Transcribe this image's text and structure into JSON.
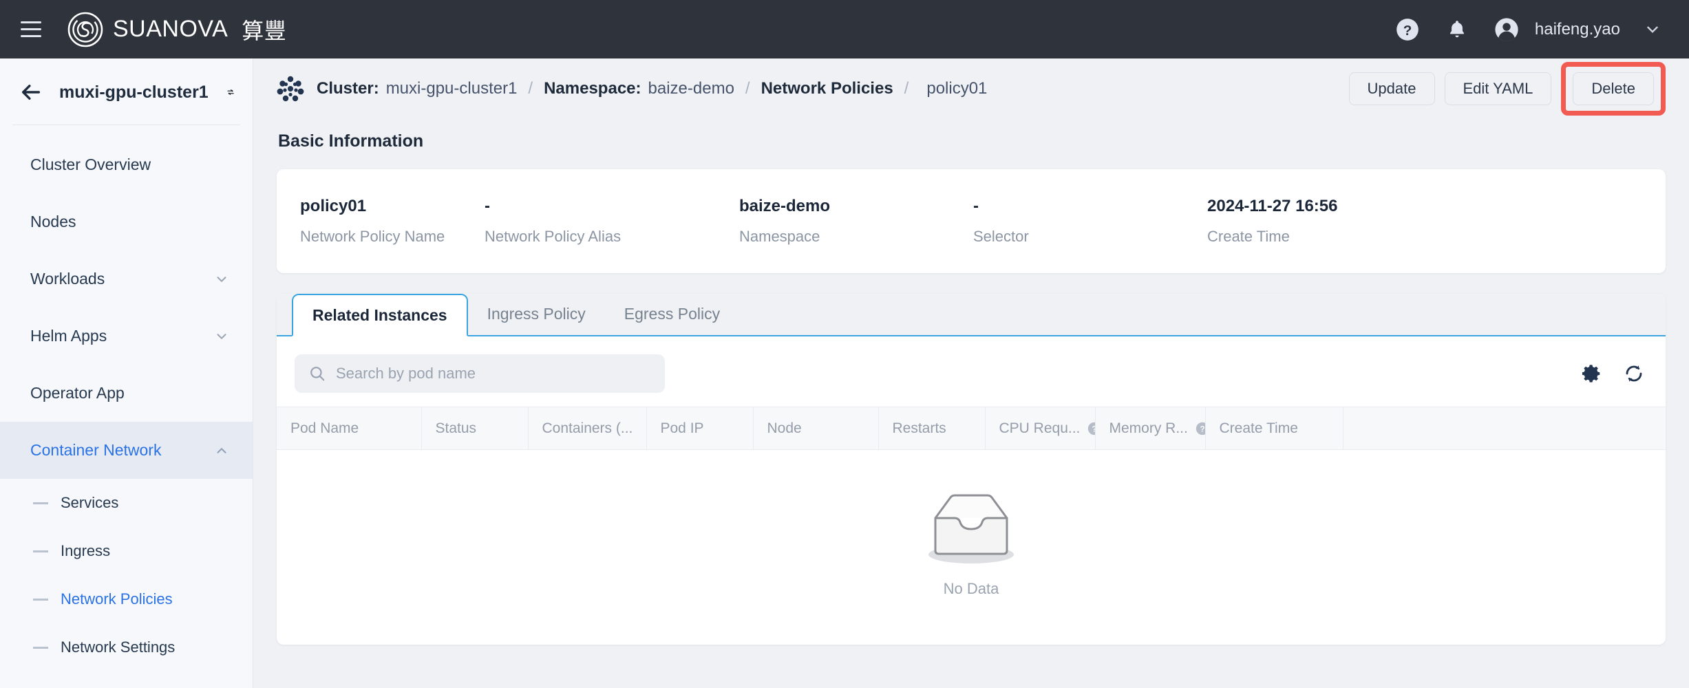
{
  "topbar": {
    "menu_icon": "hamburger-icon",
    "brand_name": "SUANOVA",
    "brand_cn": "算豐",
    "help_icon": "question-circle-icon",
    "bell_icon": "bell-icon",
    "username": "haifeng.yao",
    "caret_icon": "chevron-down-icon",
    "background": "#2f333c"
  },
  "sidebar": {
    "back_icon": "arrow-left-icon",
    "cluster_name": "muxi-gpu-cluster1",
    "switch_icon": "swap-cluster-icon",
    "items": [
      {
        "label": "Cluster Overview",
        "expandable": false
      },
      {
        "label": "Nodes",
        "expandable": false
      },
      {
        "label": "Workloads",
        "expandable": true,
        "state": "collapsed"
      },
      {
        "label": "Helm Apps",
        "expandable": true,
        "state": "collapsed"
      },
      {
        "label": "Operator App",
        "expandable": false
      },
      {
        "label": "Container Network",
        "expandable": true,
        "state": "expanded",
        "active": true
      }
    ],
    "sub_items": [
      {
        "label": "Services",
        "active": false
      },
      {
        "label": "Ingress",
        "active": false
      },
      {
        "label": "Network Policies",
        "active": true
      },
      {
        "label": "Network Settings",
        "active": false
      }
    ],
    "accent_color": "#2a72e5",
    "background": "#f6f8fb"
  },
  "breadcrumb": {
    "icon": "cluster-dots-icon",
    "cluster_label": "Cluster:",
    "cluster_value": "muxi-gpu-cluster1",
    "namespace_label": "Namespace:",
    "namespace_value": "baize-demo",
    "resource_label": "Network Policies",
    "resource_value": "policy01",
    "separator": "/"
  },
  "actions": {
    "update_label": "Update",
    "edit_yaml_label": "Edit YAML",
    "delete_label": "Delete",
    "highlight_color": "#f15b52"
  },
  "basic_information": {
    "title": "Basic Information",
    "fields": [
      {
        "value": "policy01",
        "label": "Network Policy Name"
      },
      {
        "value": "-",
        "label": "Network Policy Alias"
      },
      {
        "value": "baize-demo",
        "label": "Namespace"
      },
      {
        "value": "-",
        "label": "Selector"
      },
      {
        "value": "2024-11-27 16:56",
        "label": "Create Time"
      }
    ]
  },
  "tabs": [
    {
      "label": "Related Instances",
      "active": true
    },
    {
      "label": "Ingress Policy",
      "active": false
    },
    {
      "label": "Egress Policy",
      "active": false
    }
  ],
  "table_toolbar": {
    "search_icon": "search-icon",
    "search_placeholder": "Search by pod name",
    "search_value": "",
    "settings_icon": "gear-icon",
    "refresh_icon": "refresh-icon"
  },
  "table": {
    "columns": [
      {
        "label": "Pod Name",
        "help": false
      },
      {
        "label": "Status",
        "help": false
      },
      {
        "label": "Containers (...",
        "help": false
      },
      {
        "label": "Pod IP",
        "help": false
      },
      {
        "label": "Node",
        "help": false
      },
      {
        "label": "Restarts",
        "help": false
      },
      {
        "label": "CPU Requ...",
        "help": true
      },
      {
        "label": "Memory R...",
        "help": true
      },
      {
        "label": "Create Time",
        "help": false
      },
      {
        "label": "",
        "help": false
      }
    ],
    "rows": [],
    "empty_icon": "empty-inbox-icon",
    "empty_label": "No Data"
  }
}
